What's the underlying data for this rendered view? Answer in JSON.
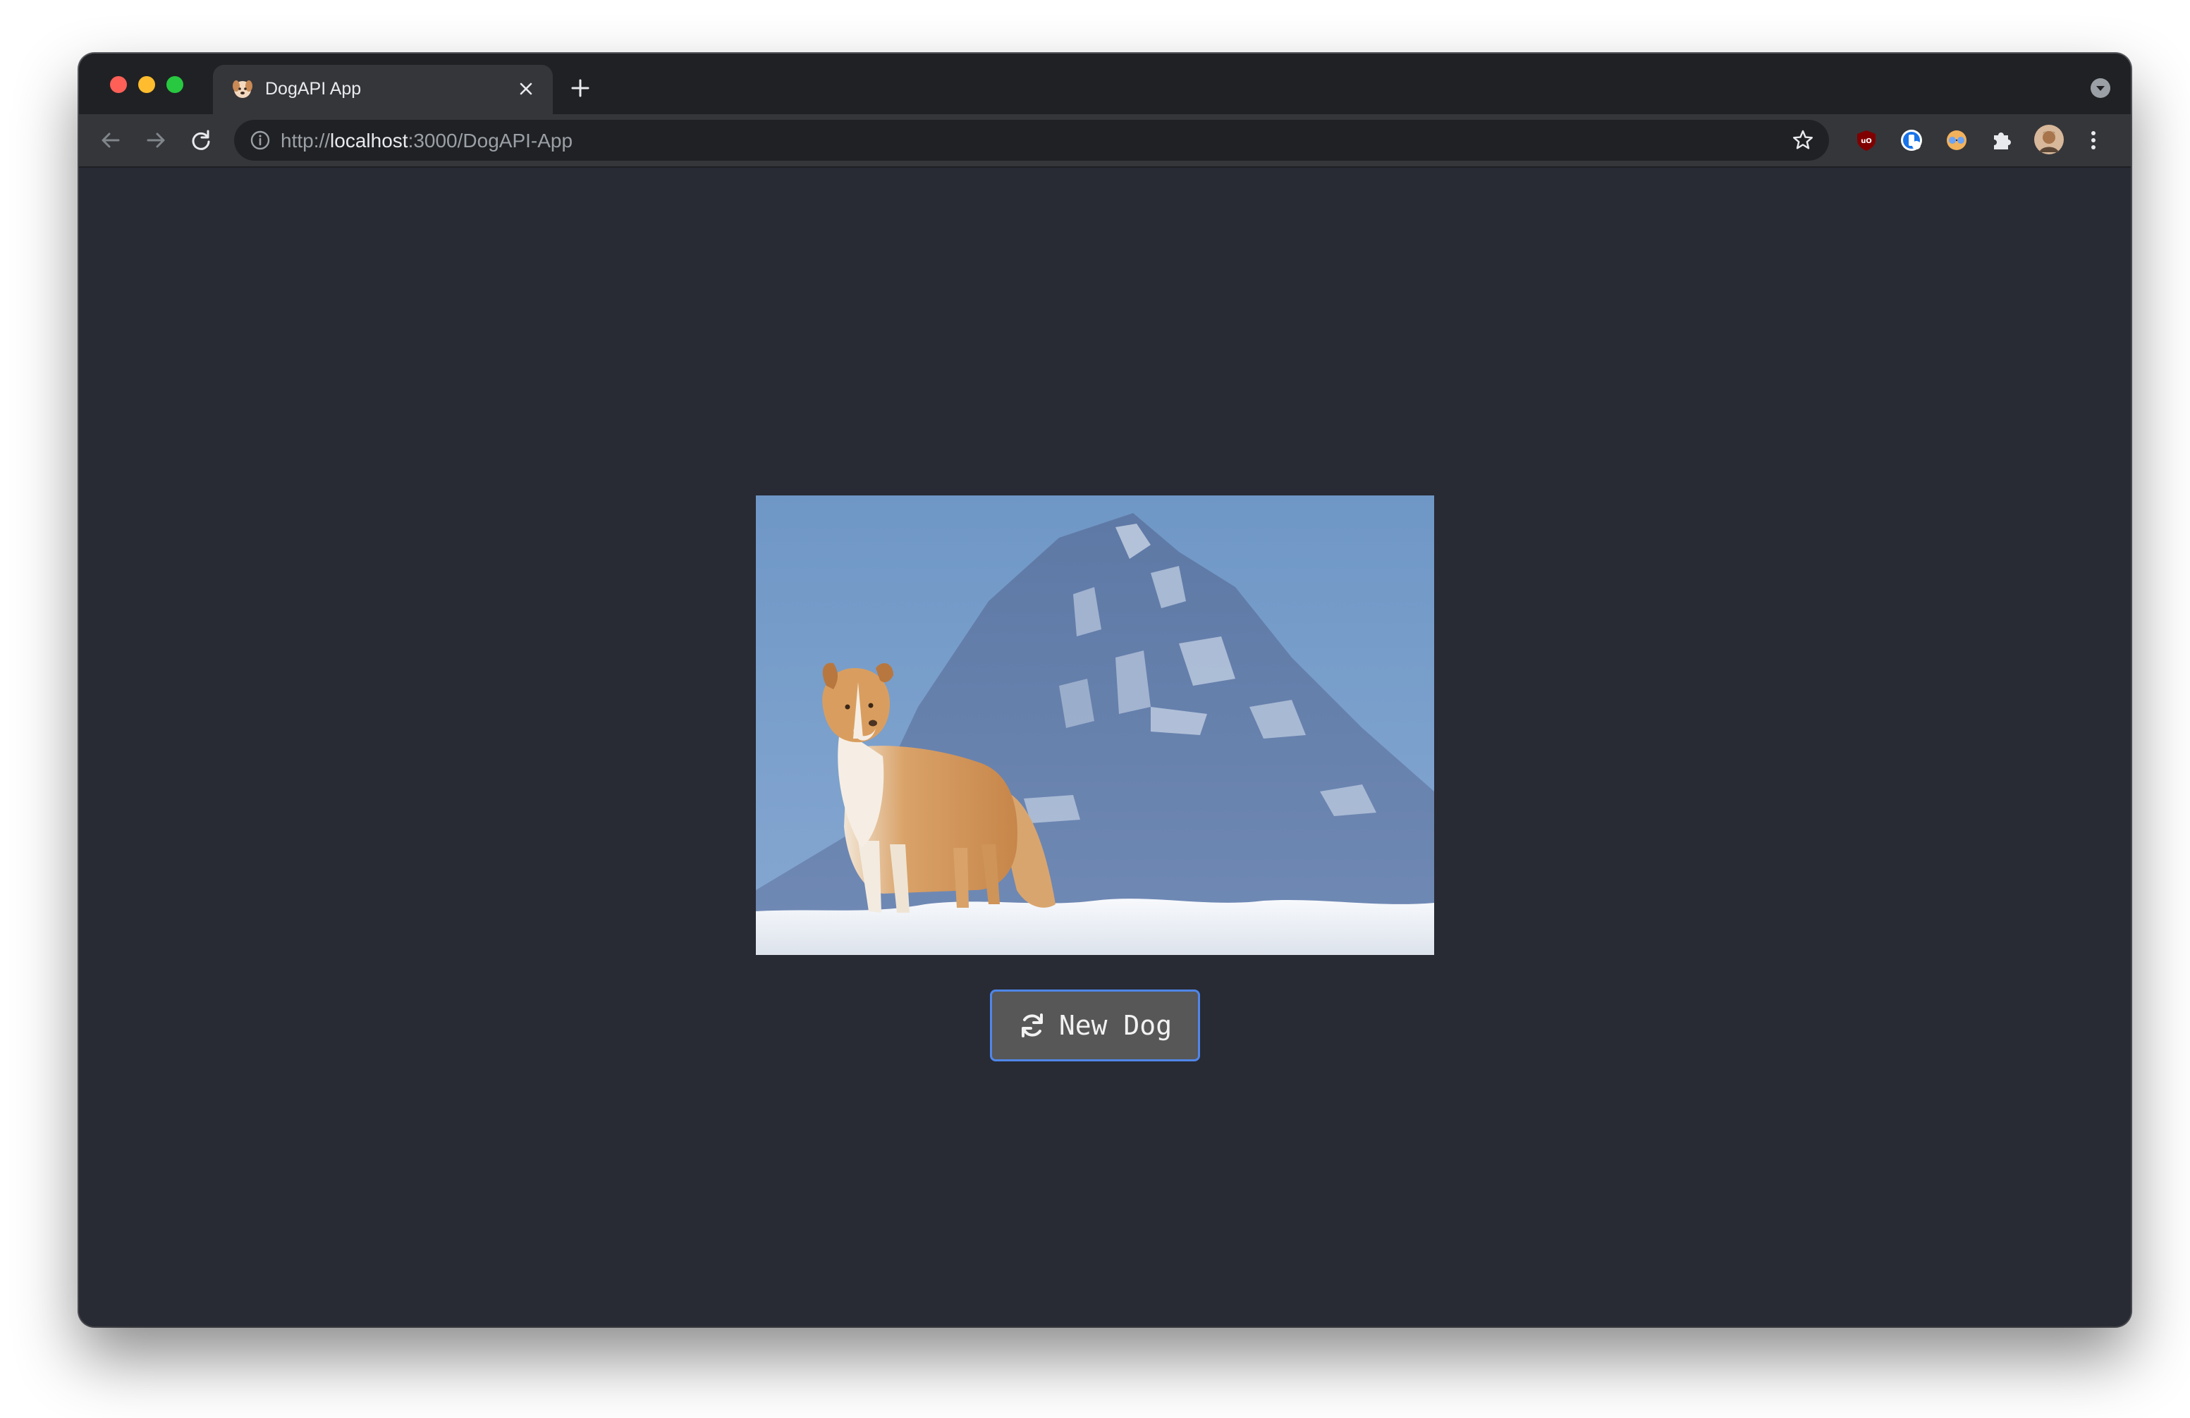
{
  "browser": {
    "tab_title": "DogAPI App",
    "url_scheme": "http://",
    "url_host": "localhost",
    "url_rest": ":3000/DogAPI-App",
    "icons": {
      "back": "arrow-left-icon",
      "forward": "arrow-right-icon",
      "reload": "reload-icon",
      "info": "info-icon",
      "bookmark": "star-icon",
      "extensions": "puzzle-icon",
      "menu": "kebab-menu-icon",
      "new_tab": "plus-icon",
      "close_tab": "close-icon",
      "tab_search": "chevron-down-icon"
    }
  },
  "app": {
    "new_dog_label": "New Dog",
    "button_icon": "refresh-icon",
    "button_color": "#575757",
    "button_border_color": "#4f86e9",
    "background_color": "#282b34"
  }
}
